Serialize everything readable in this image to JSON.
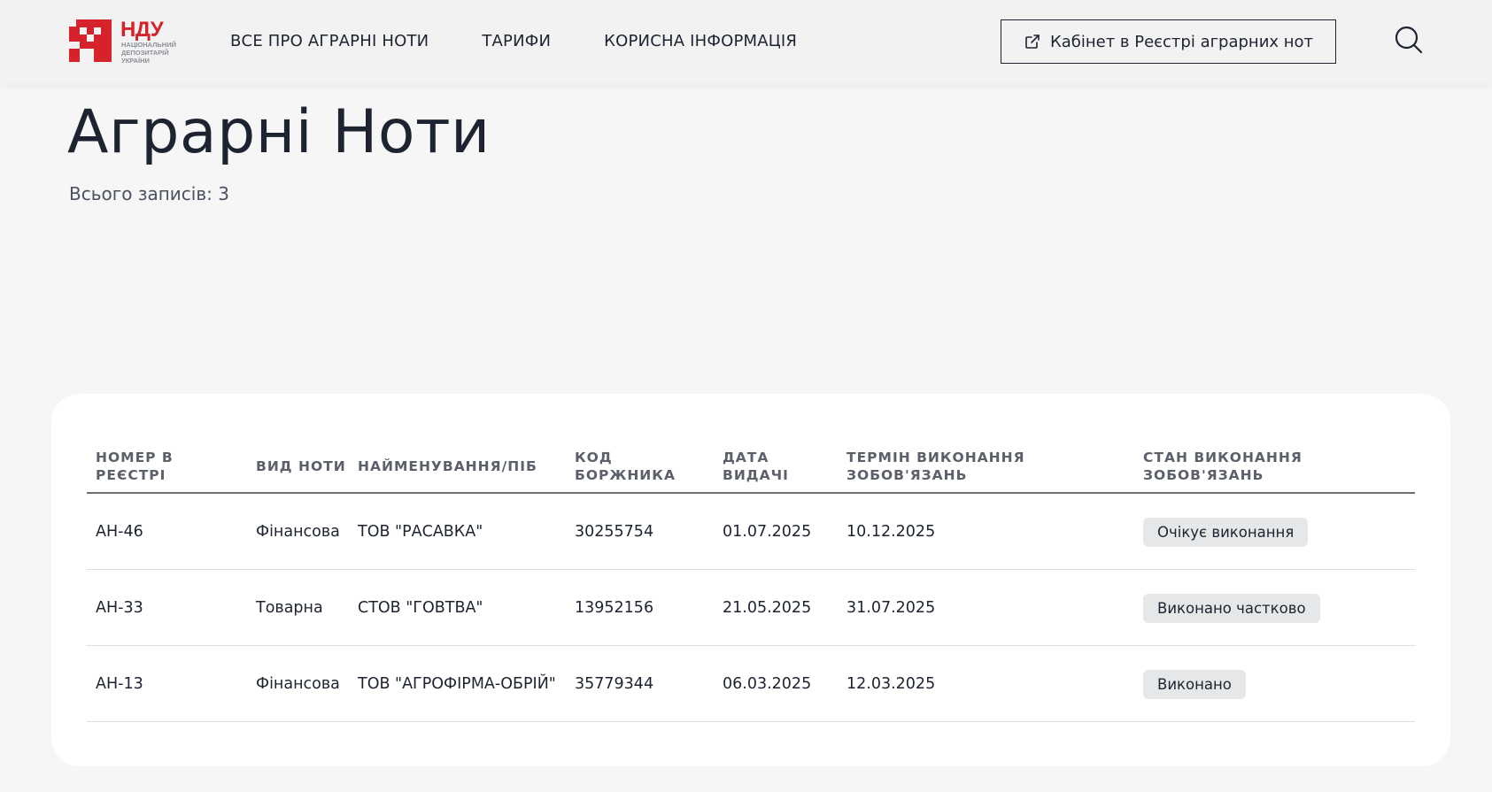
{
  "header": {
    "logo": {
      "abbr": "НДУ",
      "line1": "НАЦІОНАЛЬНИЙ",
      "line2": "ДЕПОЗИТАРІЙ",
      "line3": "УКРАЇНИ",
      "brand_color": "#d6222a"
    },
    "nav": [
      {
        "label": "ВСЕ ПРО АГРАРНІ НОТИ"
      },
      {
        "label": "ТАРИФИ"
      },
      {
        "label": "КОРИСНА ІНФОРМАЦІЯ"
      }
    ],
    "cabinet_button": {
      "label": "Кабінет в Реєстрі аграрних нот",
      "icon": "external-link-icon"
    },
    "search_icon": "search-icon"
  },
  "page": {
    "title": "Аграрні Ноти",
    "records_label": "Всього записів: 3"
  },
  "table": {
    "headers": {
      "number_line1": "НОМЕР В",
      "number_line2": "РЕЄСТРІ",
      "type": "ВИД НОТИ",
      "name": "НАЙМЕНУВАННЯ/ПІБ",
      "code_line1": "КОД",
      "code_line2": "БОРЖНИКА",
      "date_line1": "ДАТА",
      "date_line2": "ВИДАЧІ",
      "term_line1": "ТЕРМІН ВИКОНАННЯ",
      "term_line2": "ЗОБОВ'ЯЗАНЬ",
      "status_line1": "СТАН ВИКОНАННЯ",
      "status_line2": "ЗОБОВ'ЯЗАНЬ"
    },
    "rows": [
      {
        "number": "АН-46",
        "type": "Фінансова",
        "name": "ТОВ \"РАСАВКА\"",
        "code": "30255754",
        "date": "01.07.2025",
        "term": "10.12.2025",
        "status": "Очікує виконання"
      },
      {
        "number": "АН-33",
        "type": "Товарна",
        "name": "СТОВ \"ГОВТВА\"",
        "code": "13952156",
        "date": "21.05.2025",
        "term": "31.07.2025",
        "status": "Виконано частково"
      },
      {
        "number": "АН-13",
        "type": "Фінансова",
        "name": "ТОВ \"АГРОФІРМА-ОБРІЙ\"",
        "code": "35779344",
        "date": "06.03.2025",
        "term": "12.03.2025",
        "status": "Виконано"
      }
    ]
  }
}
